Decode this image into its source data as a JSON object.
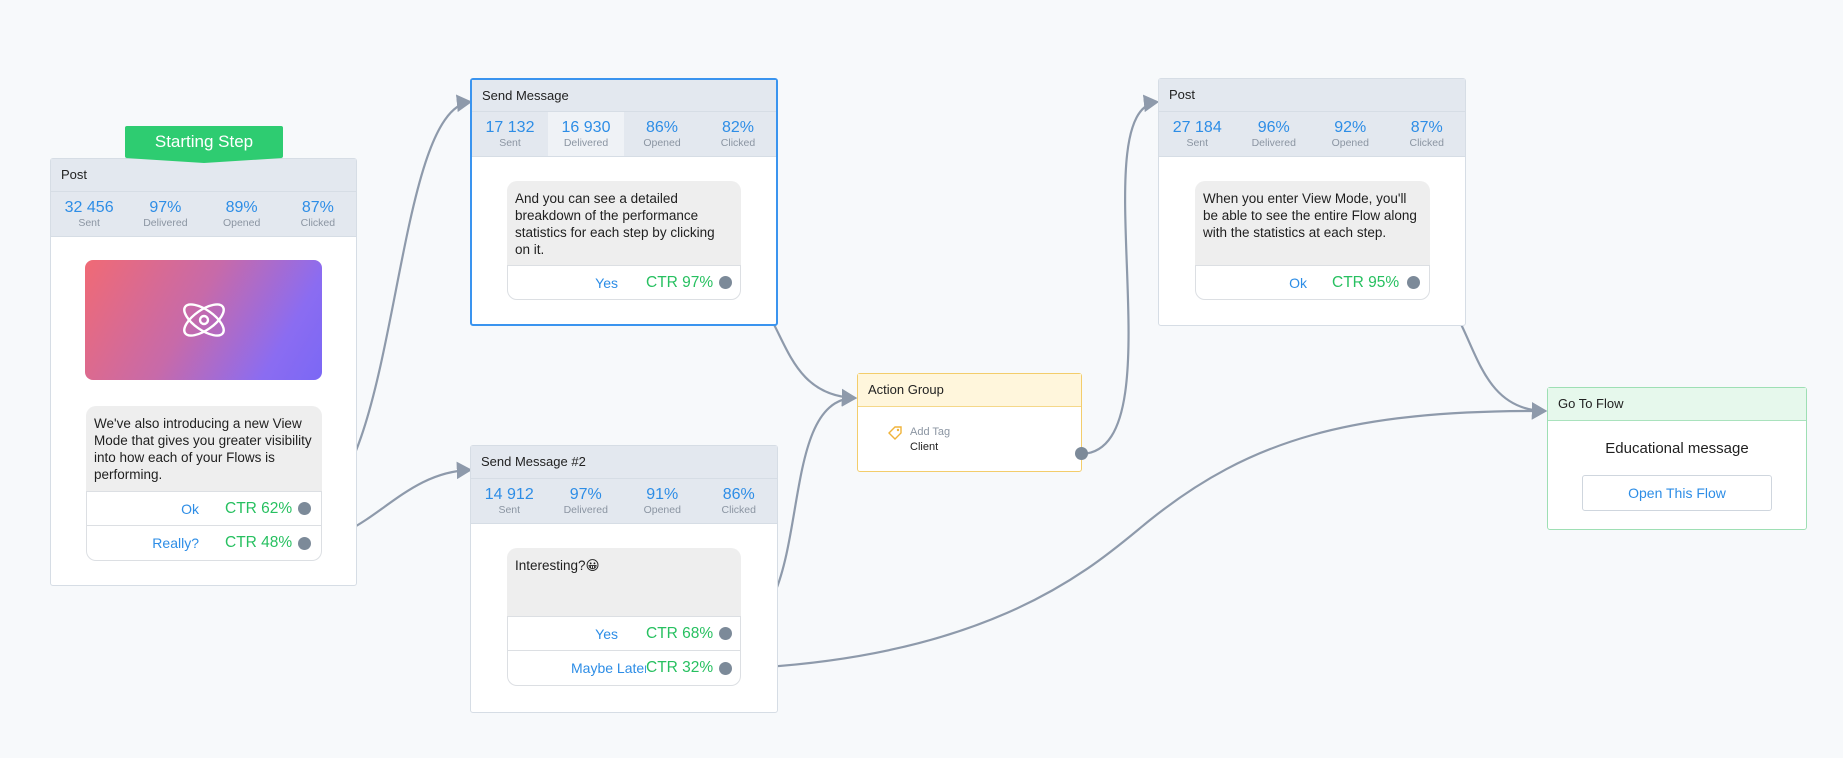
{
  "colors": {
    "accent": "#2d8de6",
    "ctr": "#27c060",
    "start": "#2ecc71",
    "port": "#7c8a99",
    "wire": "#8e9aab"
  },
  "starting_step": {
    "label": "Starting Step"
  },
  "post1": {
    "title": "Post",
    "stats": [
      {
        "value": "32 456",
        "label": "Sent"
      },
      {
        "value": "97%",
        "label": "Delivered"
      },
      {
        "value": "89%",
        "label": "Opened"
      },
      {
        "value": "87%",
        "label": "Clicked"
      }
    ],
    "media_icon": "atom-icon",
    "message": "We've also introducing a new View Mode that gives you greater visibility into how each of your Flows is performing.",
    "buttons": [
      {
        "label": "Ok",
        "ctr": "CTR 62%"
      },
      {
        "label": "Really?",
        "ctr": "CTR 48%"
      }
    ]
  },
  "send1": {
    "title": "Send Message",
    "stats": [
      {
        "value": "17 132",
        "label": "Sent"
      },
      {
        "value": "16 930",
        "label": "Delivered"
      },
      {
        "value": "86%",
        "label": "Opened"
      },
      {
        "value": "82%",
        "label": "Clicked"
      }
    ],
    "message": "And you can see a detailed breakdown of the performance statistics for each step by clicking on it.",
    "buttons": [
      {
        "label": "Yes",
        "ctr": "CTR 97%"
      }
    ]
  },
  "send2": {
    "title": "Send Message #2",
    "stats": [
      {
        "value": "14 912",
        "label": "Sent"
      },
      {
        "value": "97%",
        "label": "Delivered"
      },
      {
        "value": "91%",
        "label": "Opened"
      },
      {
        "value": "86%",
        "label": "Clicked"
      }
    ],
    "message": "Interesting?😀",
    "buttons": [
      {
        "label": "Yes",
        "ctr": "CTR 68%"
      },
      {
        "label": "Maybe Later",
        "ctr": "CTR 32%"
      }
    ]
  },
  "action": {
    "title": "Action Group",
    "tag_icon": "tag-icon",
    "tag_label": "Add Tag",
    "tag_value": "Client"
  },
  "post2": {
    "title": "Post",
    "stats": [
      {
        "value": "27 184",
        "label": "Sent"
      },
      {
        "value": "96%",
        "label": "Delivered"
      },
      {
        "value": "92%",
        "label": "Opened"
      },
      {
        "value": "87%",
        "label": "Clicked"
      }
    ],
    "message": "When you enter View Mode, you'll be able to see the entire Flow along with the statistics at each step.",
    "buttons": [
      {
        "label": "Ok",
        "ctr": "CTR 95%"
      }
    ]
  },
  "goto": {
    "title": "Go To Flow",
    "flow_name": "Educational message",
    "open_button": "Open This Flow"
  }
}
